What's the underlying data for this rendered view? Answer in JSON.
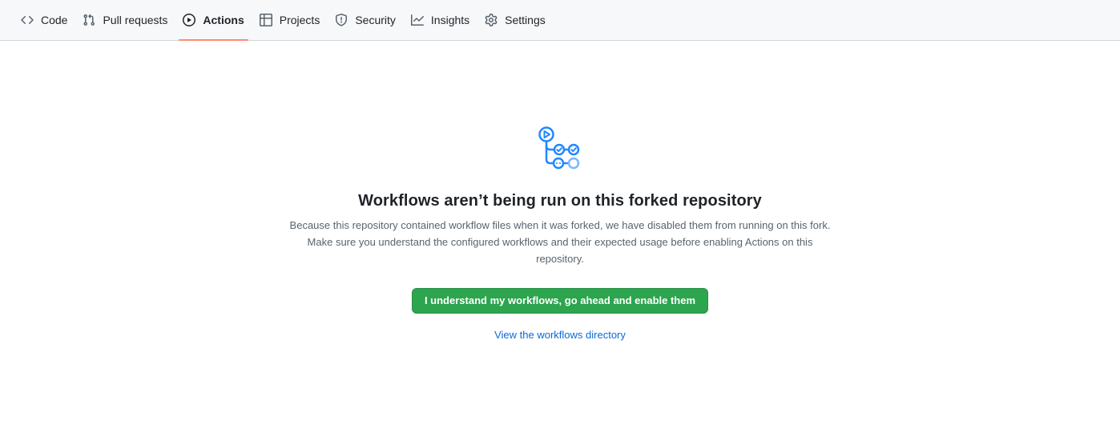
{
  "nav": {
    "items": [
      {
        "label": "Code",
        "icon": "code-icon"
      },
      {
        "label": "Pull requests",
        "icon": "git-pull-request-icon"
      },
      {
        "label": "Actions",
        "icon": "play-icon",
        "selected": true
      },
      {
        "label": "Projects",
        "icon": "table-icon"
      },
      {
        "label": "Security",
        "icon": "shield-icon"
      },
      {
        "label": "Insights",
        "icon": "graph-icon"
      },
      {
        "label": "Settings",
        "icon": "gear-icon"
      }
    ]
  },
  "blankslate": {
    "icon": "workflow-icon",
    "title": "Workflows aren’t being run on this forked repository",
    "description": "Because this repository contained workflow files when it was forked, we have disabled them from running on this fork. Make sure you understand the configured workflows and their expected usage before enabling Actions on this repository.",
    "enable_button": "I understand my workflows, go ahead and enable them",
    "directory_link": "View the workflows directory"
  },
  "colors": {
    "accent_underline": "#fd8c73",
    "primary_button": "#2da44e",
    "link": "#0969da",
    "icon_blue": "#2188ff"
  }
}
